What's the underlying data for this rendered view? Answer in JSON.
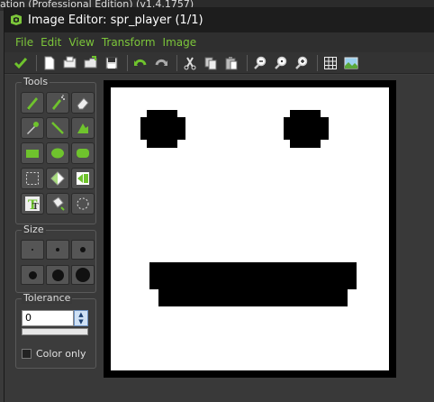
{
  "background_window": {
    "title": "ation (Professional Edition)  (v1.4.1757)"
  },
  "window": {
    "title": "Image Editor: spr_player (1/1)"
  },
  "menu": {
    "items": [
      "File",
      "Edit",
      "View",
      "Transform",
      "Image"
    ]
  },
  "toolbar": {
    "buttons": [
      "confirm-icon",
      "new-icon",
      "open-icon",
      "open-folder-icon",
      "save-icon",
      "undo-icon",
      "redo-icon",
      "cut-icon",
      "copy-icon",
      "paste-icon",
      "zoom-out-icon",
      "zoom-reset-icon",
      "zoom-in-icon",
      "grid-icon",
      "image-preview-icon"
    ]
  },
  "panels": {
    "tools": {
      "label": "Tools"
    },
    "size": {
      "label": "Size"
    },
    "tolerance": {
      "label": "Tolerance",
      "value": "0",
      "color_only_label": "Color only",
      "color_only_checked": false
    }
  },
  "colors": {
    "accent": "#7cc63a",
    "canvas_bg": "#ffffff",
    "panel_bg": "#3c3c3c"
  }
}
